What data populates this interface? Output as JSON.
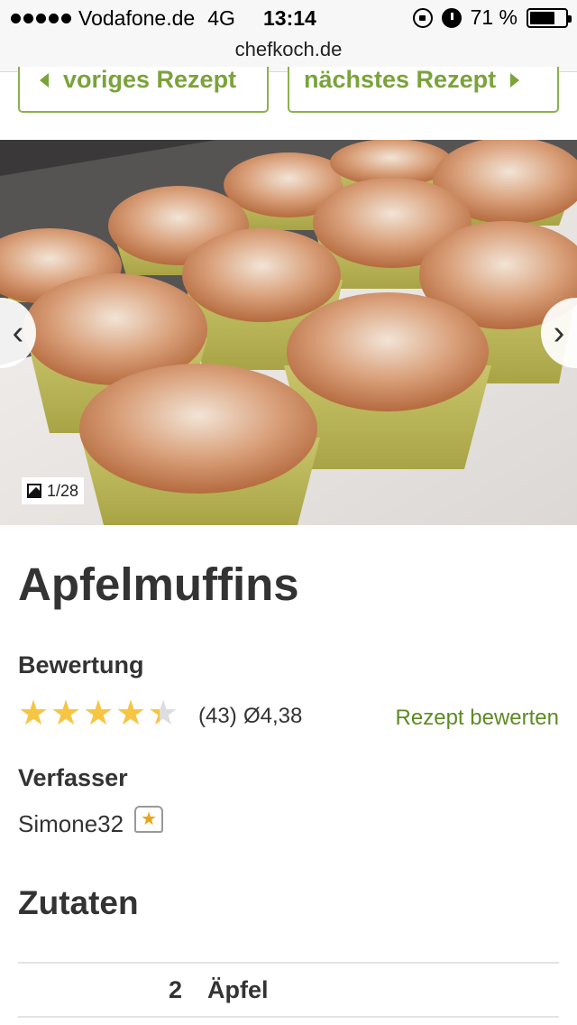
{
  "status_bar": {
    "carrier": "Vodafone.de",
    "network": "4G",
    "time": "13:14",
    "battery": "71 %",
    "battery_level": 0.71
  },
  "browser": {
    "url": "chefkoch.de"
  },
  "recipe_nav": {
    "prev_label": "voriges Rezept",
    "next_label": "nächstes Rezept"
  },
  "gallery": {
    "counter": "1/28",
    "prev_icon": "chevron-left-icon",
    "next_icon": "chevron-right-icon"
  },
  "recipe": {
    "title": "Apfelmuffins",
    "rating_label": "Bewertung",
    "rating_value": 4.38,
    "rating_count": "(43)",
    "rating_avg": "Ø4,38",
    "rate_link": "Rezept bewerten",
    "author_label": "Verfasser",
    "author": "Simone32",
    "ingredients_title": "Zutaten",
    "ingredients": [
      {
        "amount": "2",
        "name": "Äpfel"
      }
    ]
  },
  "colors": {
    "accent_green": "#7aa33a",
    "link_green": "#5e8a25",
    "star_gold": "#f6c543"
  }
}
